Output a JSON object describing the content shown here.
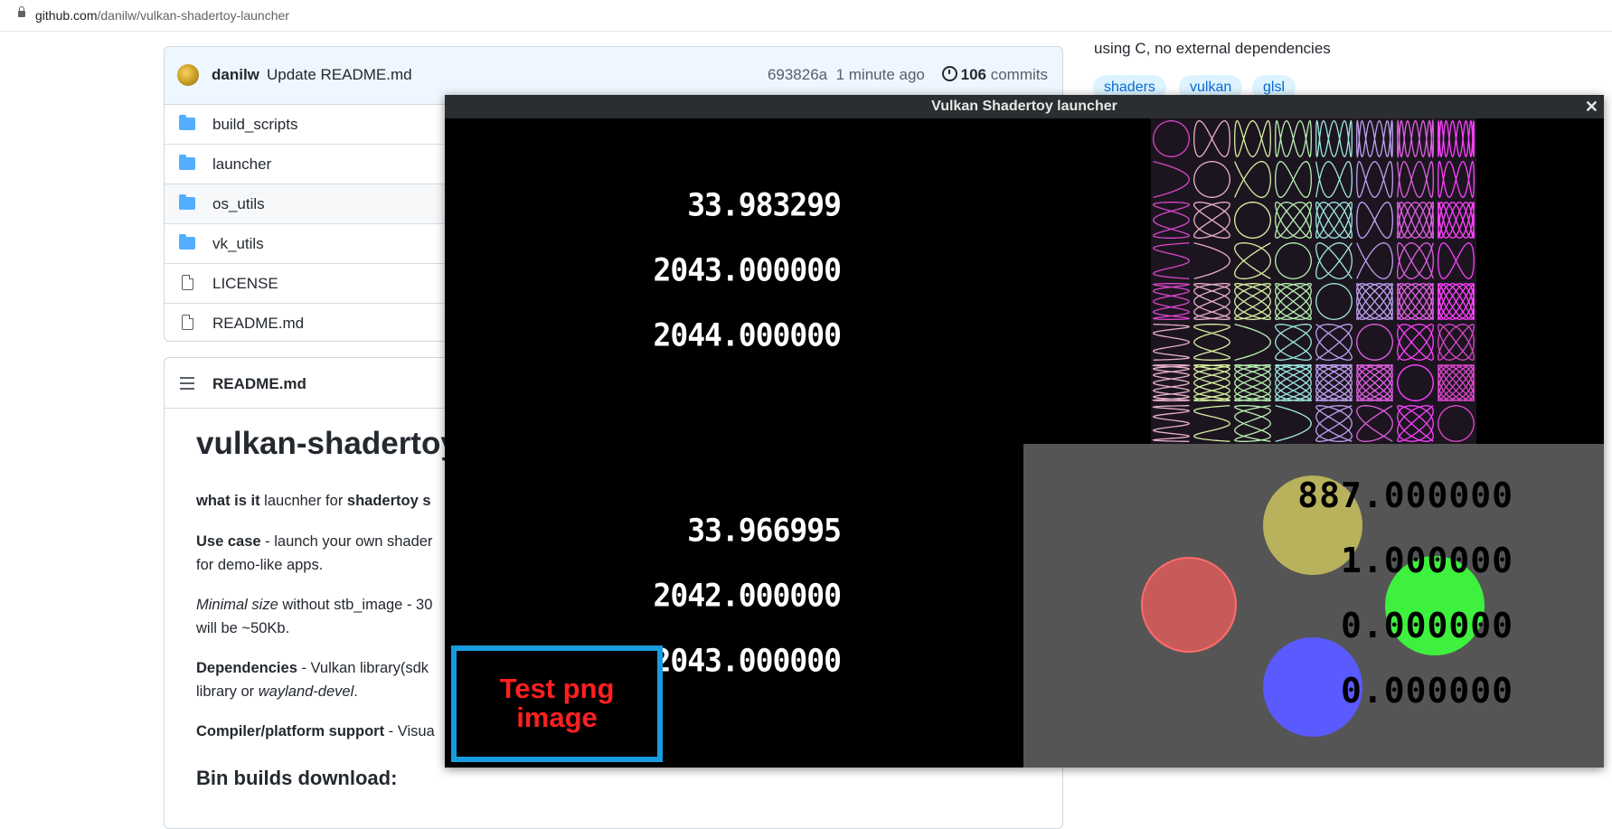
{
  "browser": {
    "url_host": "github.com",
    "url_path": "/danilw/vulkan-shadertoy-launcher"
  },
  "commit": {
    "author": "danilw",
    "message": "Update README.md",
    "hash": "693826a",
    "time": "1 minute ago",
    "count": "106",
    "count_label": "commits"
  },
  "files": [
    {
      "name": "build_scripts",
      "type": "folder"
    },
    {
      "name": "launcher",
      "type": "folder"
    },
    {
      "name": "os_utils",
      "type": "folder"
    },
    {
      "name": "vk_utils",
      "type": "folder"
    },
    {
      "name": "LICENSE",
      "type": "file"
    },
    {
      "name": "README.md",
      "type": "file"
    }
  ],
  "readme": {
    "header": "README.md",
    "title": "vulkan-shadertoy",
    "p1_bold": "what is it",
    "p1_rest": " laucnher for ",
    "p1_bold2": "shadertoy s",
    "p2_bold": "Use case",
    "p2_rest": " - launch your own shader",
    "p2_line2": "for demo-like apps.",
    "p3_ital": "Minimal size",
    "p3_rest": " without stb_image - 30",
    "p3_line2": "will be ~50Kb.",
    "p4_bold": "Dependencies",
    "p4_rest": " - Vulkan library(sdk",
    "p4_line2a": "library or ",
    "p4_line2_ital": "wayland-devel",
    "p4_line2b": ".",
    "p5_bold": "Compiler/platform support",
    "p5_rest": " - Visua",
    "h2": "Bin builds download:"
  },
  "about": {
    "description": "using C, no external dependencies",
    "topics": [
      "shaders",
      "vulkan",
      "glsl"
    ]
  },
  "window": {
    "title": "Vulkan Shadertoy launcher",
    "close": "✕",
    "numbers_top": [
      "33.983299",
      "2043.000000",
      "2044.000000"
    ],
    "numbers_bottom": [
      "33.966995",
      "2042.000000",
      "2043.000000"
    ],
    "gray_numbers": [
      "887.000000",
      "1.000000",
      "0.000000",
      "0.000000"
    ],
    "png_text_line1": "Test png",
    "png_text_line2": "image",
    "colors": {
      "red_circle": "#c85a5a",
      "yellow_circle": "#b9b25c",
      "green_circle": "#3dff3d",
      "blue_circle": "#5a5aff",
      "png_border": "#1a9be0",
      "png_text": "#ff2020"
    }
  }
}
